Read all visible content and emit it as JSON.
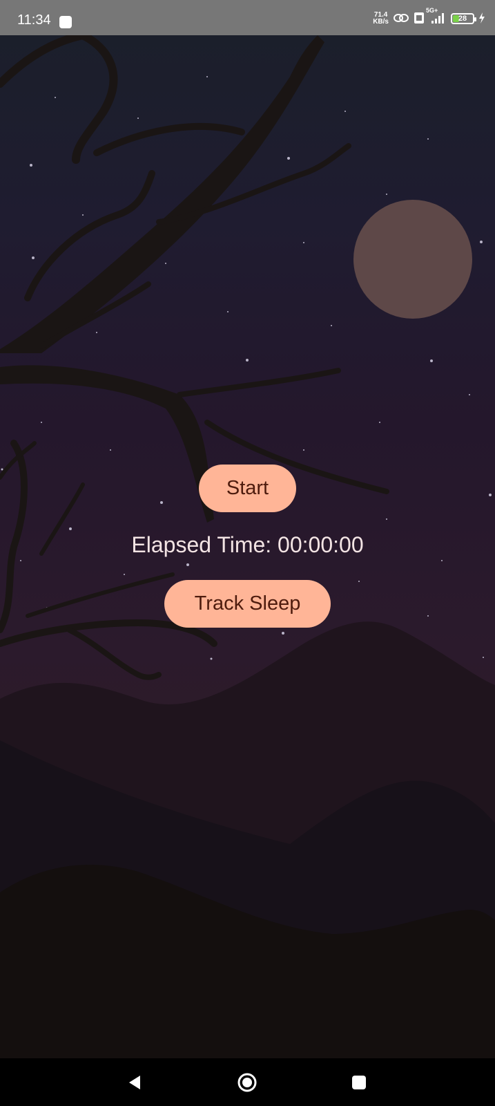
{
  "status_bar": {
    "time": "11:34",
    "net_speed_value": "71.4",
    "net_speed_unit": "KB/s",
    "network_type": "5G+",
    "battery_level": "28"
  },
  "main": {
    "start_label": "Start",
    "elapsed_label": "Elapsed Time: 00:00:00",
    "track_sleep_label": "Track Sleep"
  },
  "colors": {
    "button_bg": "#ffb597",
    "button_text": "#4e1c0e",
    "moon": "#5e4848",
    "status_bar_bg": "#777777"
  },
  "icons": {
    "nav": [
      "back-icon",
      "home-icon",
      "recents-icon"
    ]
  }
}
